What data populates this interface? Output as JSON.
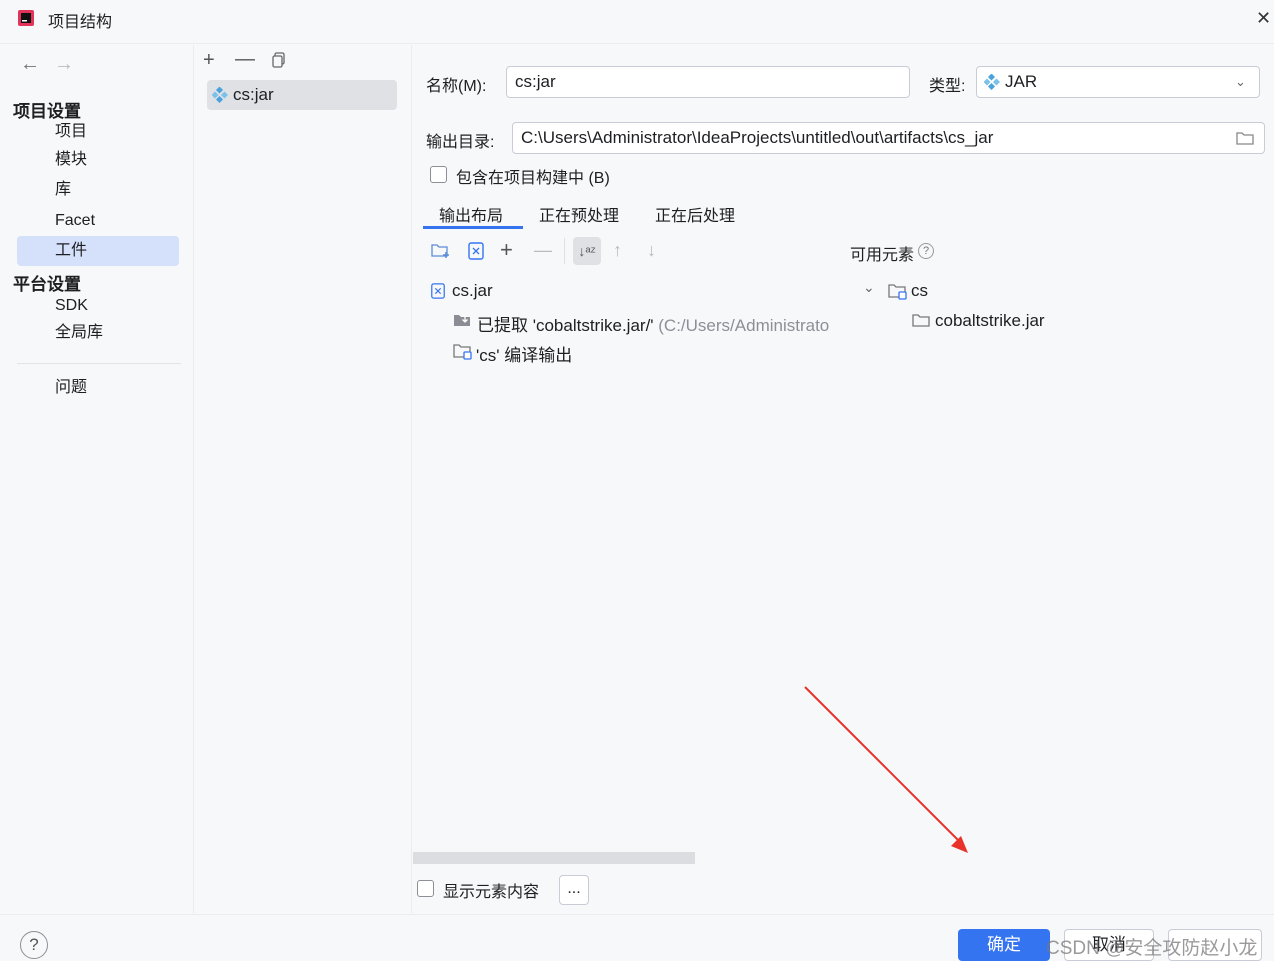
{
  "window": {
    "title": "项目结构",
    "close_icon": "close-icon"
  },
  "nav": {
    "section1": "项目设置",
    "items1": [
      "项目",
      "模块",
      "库",
      "Facet",
      "工件"
    ],
    "selected": "工件",
    "section2": "平台设置",
    "items2": [
      "SDK",
      "全局库"
    ],
    "problems": "问题"
  },
  "artifacts": {
    "items": [
      "cs:jar"
    ]
  },
  "form": {
    "name_label": "名称(M):",
    "name_value": "cs:jar",
    "type_label": "类型:",
    "type_value": "JAR",
    "output_label": "输出目录:",
    "output_value": "C:\\Users\\Administrator\\IdeaProjects\\untitled\\out\\artifacts\\cs_jar",
    "include_label": "包含在项目构建中 (B)",
    "include_checked": false
  },
  "tabs": [
    "输出布局",
    "正在预处理",
    "正在后处理"
  ],
  "active_tab": "输出布局",
  "layout_tree": {
    "root": "cs.jar",
    "children": [
      {
        "prefix": "已提取 'cobaltstrike.jar/'",
        "suffix": " (C:/Users/Administrato"
      },
      {
        "label": "'cs' 编译输出"
      }
    ]
  },
  "available": {
    "title": "可用元素",
    "root": "cs",
    "children": [
      "cobaltstrike.jar"
    ]
  },
  "show_content_label": "显示元素内容",
  "more_label": "...",
  "buttons": {
    "help": "?",
    "ok": "确定",
    "cancel": "取消"
  },
  "watermark": "CSDN @安全攻防赵小龙",
  "colors": {
    "accent": "#3574f0",
    "selection": "#d5e1fb",
    "arrow": "#e8322a"
  }
}
